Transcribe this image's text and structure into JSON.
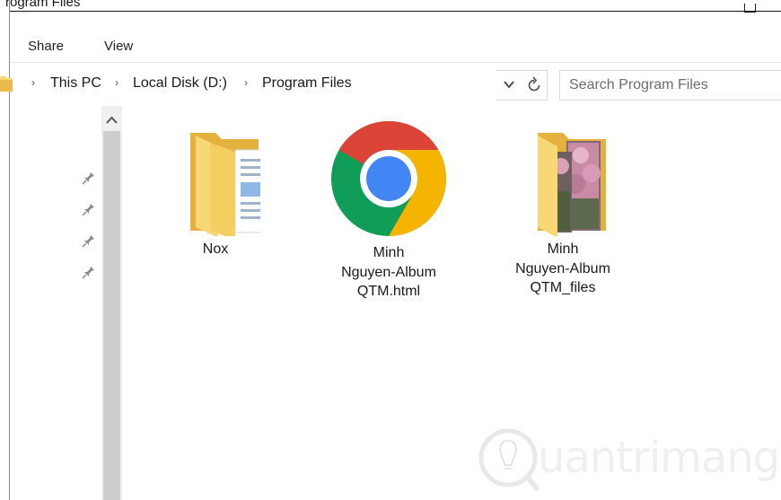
{
  "window": {
    "title": "rogram Files"
  },
  "ribbon": {
    "tabs": [
      {
        "label": "Share"
      },
      {
        "label": "View"
      }
    ]
  },
  "navigation": {
    "breadcrumbs": [
      {
        "label": "This PC"
      },
      {
        "label": "Local Disk (D:)"
      },
      {
        "label": "Program Files"
      }
    ],
    "separator": "›",
    "search_placeholder": "Search Program Files"
  },
  "files": [
    {
      "name": "Nox",
      "icon": "folder-documents-icon"
    },
    {
      "name": "Minh Nguyen-Album QTM.html",
      "lines": [
        "Minh",
        "Nguyen-Album",
        "QTM.html"
      ],
      "icon": "chrome-html-file-icon"
    },
    {
      "name": "Minh Nguyen-Album QTM_files",
      "lines": [
        "Minh",
        "Nguyen-Album",
        "QTM_files"
      ],
      "icon": "folder-pictures-icon"
    }
  ],
  "watermark": {
    "text": "uantrimang",
    "colors": {
      "accent": "#dedede"
    }
  },
  "colors": {
    "folder": "#f8d775",
    "folder_dark": "#e4b23c",
    "chrome_red": "#db4437",
    "chrome_green": "#0f9d58",
    "chrome_yellow": "#f4b400",
    "chrome_blue": "#4285f4",
    "scrollbar_thumb": "#cdcdcd"
  }
}
